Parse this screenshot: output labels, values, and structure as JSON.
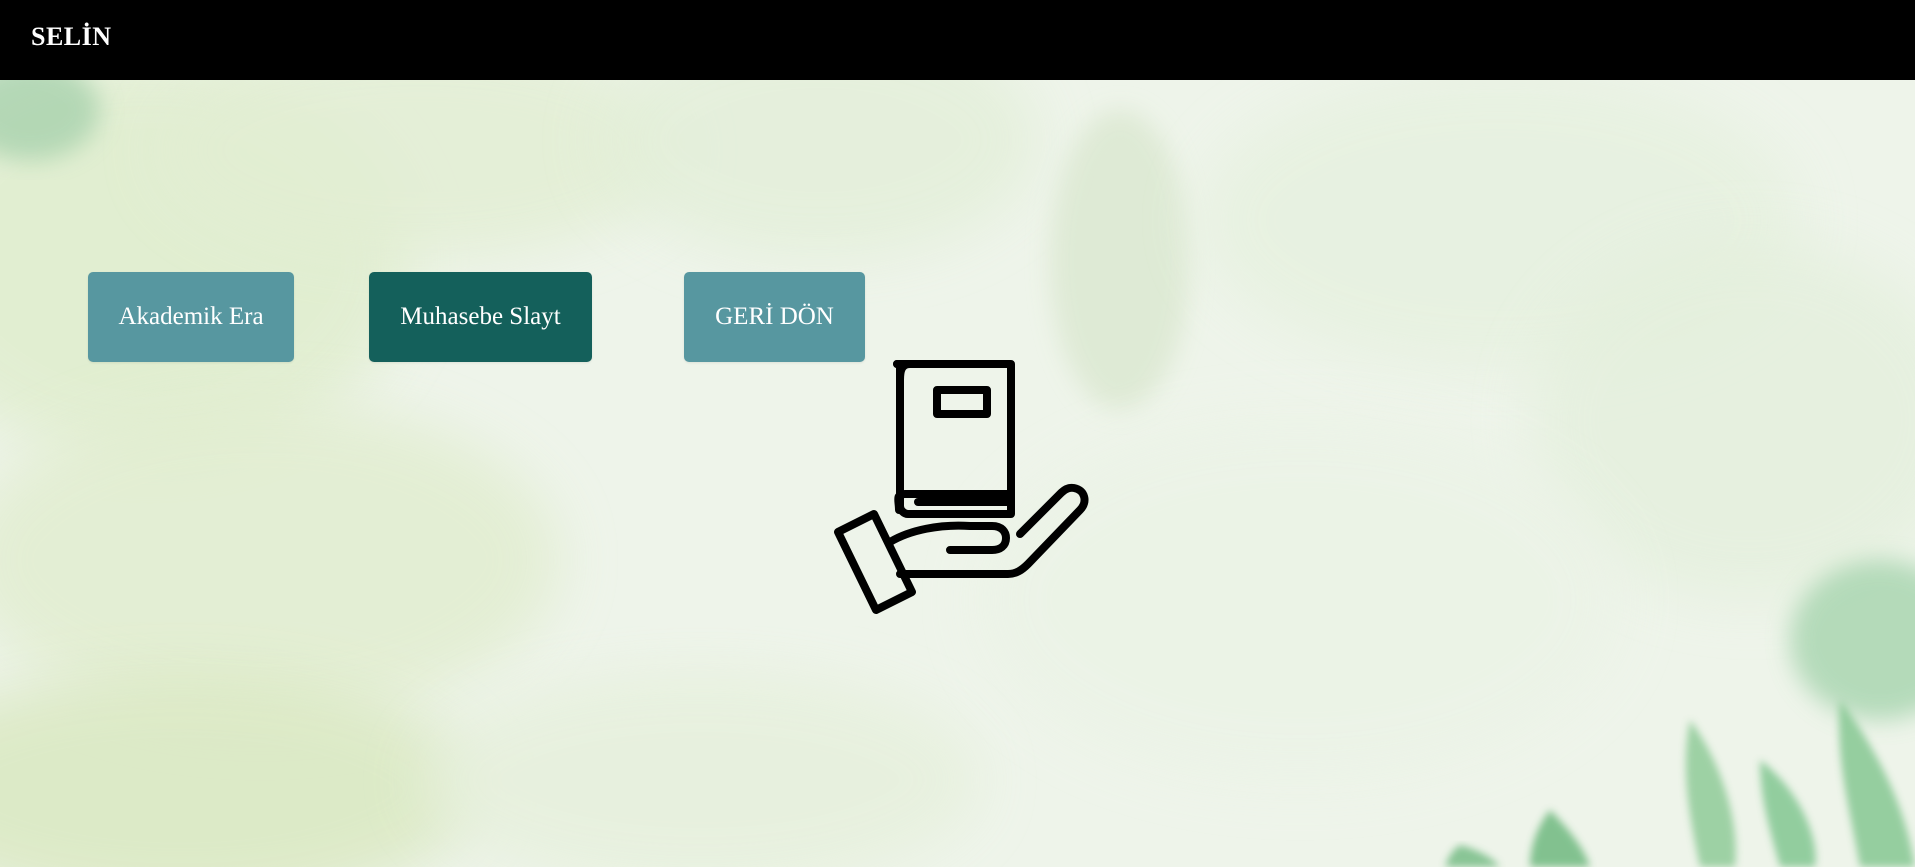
{
  "header": {
    "brand": "SELİN"
  },
  "buttons": [
    {
      "label": "Akademik Era",
      "color": "#5797a0"
    },
    {
      "label": "Muhasebe Slayt",
      "color": "#14605b"
    },
    {
      "label": "GERİ DÖN",
      "color": "#5797a0"
    }
  ],
  "illustration": {
    "icon": "book-in-hand-icon"
  },
  "colors": {
    "topbar": "#000000",
    "background": "#eef4ea",
    "leaf_green": "#7cc48c"
  }
}
